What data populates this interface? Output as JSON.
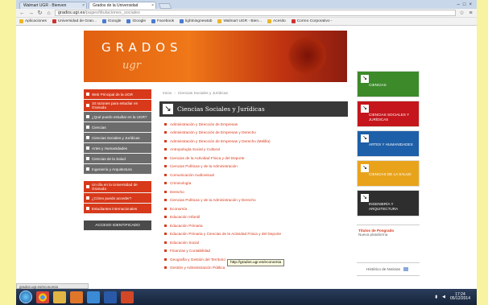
{
  "browser": {
    "tabs": [
      {
        "label": "Walmart UGR - Bienven",
        "active": false
      },
      {
        "label": "Grados de la Universidad",
        "active": true
      }
    ],
    "url_host": "grados.ugr.es",
    "url_path": "/pages/titulaciones_sociales",
    "bookmarks": [
      {
        "label": "Aplicaciones",
        "icon": "apps-icon"
      },
      {
        "label": "Universidad de Gran...",
        "icon": "bookmark-icon"
      },
      {
        "label": "iGoogle",
        "icon": "bookmark-icon"
      },
      {
        "label": "iGoogle",
        "icon": "bookmark-icon"
      },
      {
        "label": "Facebook",
        "icon": "bookmark-icon"
      },
      {
        "label": "lightningnewtab",
        "icon": "bookmark-icon"
      },
      {
        "label": "Walmart UGR - Bien...",
        "icon": "bookmark-icon"
      },
      {
        "label": "Acesito",
        "icon": "bookmark-icon"
      },
      {
        "label": "Correo Corporativo -",
        "icon": "bookmark-icon"
      }
    ],
    "status_url": "grados.ugr.es/economia"
  },
  "banner": {
    "title": "GRADOS",
    "subtitle": "ugr"
  },
  "left_nav": {
    "group1": [
      {
        "label": "Web Principal de la UGR",
        "style": "red"
      },
      {
        "label": "10 razones para estudiar en Granada",
        "style": "red"
      },
      {
        "label": "¿Qué puedo estudiar en la UGR?",
        "style": "gray"
      },
      {
        "label": "Ciencias",
        "style": "gray"
      },
      {
        "label": "Ciencias Sociales y Jurídicas",
        "style": "gray"
      },
      {
        "label": "Artes y Humanidades",
        "style": "gray"
      },
      {
        "label": "Ciencias de la Salud",
        "style": "gray"
      },
      {
        "label": "Ingeniería y Arquitectura",
        "style": "gray"
      }
    ],
    "group2": [
      {
        "label": "Un día en la Universidad de Granada",
        "style": "red"
      },
      {
        "label": "¿Cómo puedo acceder?",
        "style": "red"
      },
      {
        "label": "Estudiantes internacionales",
        "style": "red"
      }
    ],
    "access_label": "ACCESO IDENTIFICADO"
  },
  "main": {
    "breadcrumb": [
      "Inicio",
      "Ciencias Sociales y Jurídicas"
    ],
    "section_title": "Ciencias Sociales y Jurídicas",
    "degrees": [
      "Administración y Dirección de Empresas",
      "Administración y Dirección de Empresas y Derecho",
      "Administración y Dirección de Empresas y Derecho (Melilla)",
      "Antropología Social y Cultural",
      "Ciencias de la Actividad Física y del Deporte",
      "Ciencias Políticas y de la Administración",
      "Comunicación Audiovisual",
      "Criminología",
      "Derecho",
      "Ciencias Políticas y de la Administración y Derecho",
      "Economía",
      "Educación Infantil",
      "Educación Primaria",
      "Educación Primaria y Ciencias de la Actividad Física y del Deporte",
      "Educación Social",
      "Finanzas y Contabilidad",
      "Geografía y Gestión del Territorio",
      "Gestión y Administración Pública"
    ],
    "tooltip": "http://grados.ugr.es/economia"
  },
  "right_col": {
    "categories": [
      {
        "label": "CIENCIAS",
        "color": "#3c8a2a"
      },
      {
        "label": "CIENCIAS SOCIALES Y JURÍDICAS",
        "color": "#c4161c"
      },
      {
        "label": "ARTES Y HUMANIDADES",
        "color": "#1d5fa8"
      },
      {
        "label": "CIENCIAS DE LA SALUD",
        "color": "#e9a31b"
      },
      {
        "label": "INGENIERÍA Y ARQUITECTURA",
        "color": "#2e2e2e"
      }
    ],
    "posgrado_title": "Títulos de Posgrado",
    "posgrado_sub": "Nueva plataforma",
    "historico": "Histórico de Noticias"
  },
  "taskbar": {
    "time": "17:24",
    "date": "05/12/2014"
  }
}
